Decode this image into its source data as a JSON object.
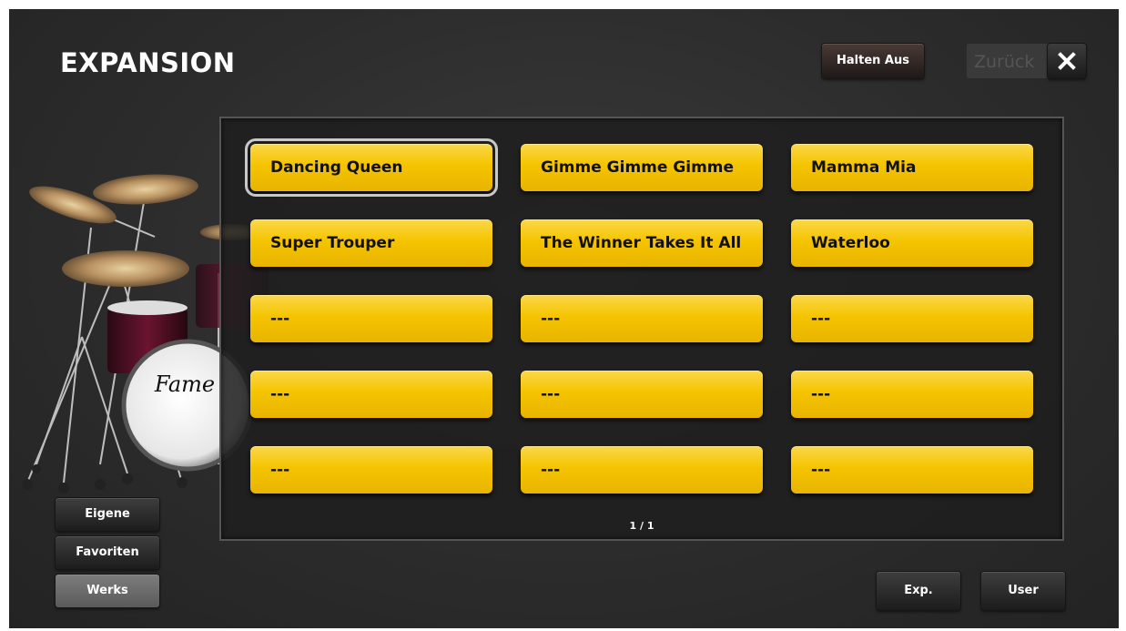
{
  "header": {
    "title": "EXPANSION",
    "hold_label": "Halten Aus",
    "back_label": "Zurück"
  },
  "drum_logo": "Fame",
  "songs": [
    {
      "label": "Dancing Queen",
      "selected": true
    },
    {
      "label": "Gimme Gimme Gimme"
    },
    {
      "label": "Mamma Mia"
    },
    {
      "label": "Super Trouper"
    },
    {
      "label": "The Winner Takes It All"
    },
    {
      "label": "Waterloo"
    },
    {
      "label": "---"
    },
    {
      "label": "---"
    },
    {
      "label": "---"
    },
    {
      "label": "---"
    },
    {
      "label": "---"
    },
    {
      "label": "---"
    },
    {
      "label": "---"
    },
    {
      "label": "---"
    },
    {
      "label": "---"
    }
  ],
  "pagination": "1 / 1",
  "categories": [
    {
      "label": "Eigene"
    },
    {
      "label": "Favoriten"
    },
    {
      "label": "Werks",
      "active": true
    }
  ],
  "footer": {
    "exp_label": "Exp.",
    "user_label": "User"
  },
  "colors": {
    "song_button": "#f5c400",
    "background": "#2c2c2c",
    "selection_outline": "#c8c8c8"
  }
}
